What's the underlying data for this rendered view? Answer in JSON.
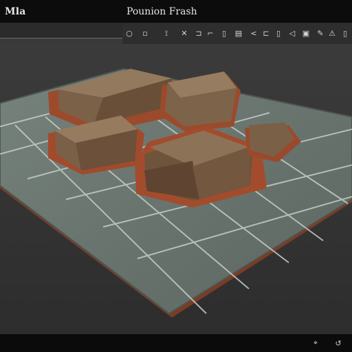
{
  "app": {
    "name": "Mla"
  },
  "document": {
    "title": "Pounion Frash"
  },
  "toolbar": {
    "tools": [
      {
        "icon": "circle-icon",
        "glyph": "○"
      },
      {
        "icon": "square-icon",
        "glyph": "▫"
      },
      {
        "icon": "pin-icon",
        "glyph": "⟟"
      },
      {
        "icon": "close-icon",
        "glyph": "✕"
      },
      {
        "icon": "bracket-icon",
        "glyph": "⊐"
      },
      {
        "icon": "crop-icon",
        "glyph": "⌐"
      },
      {
        "icon": "file-icon",
        "glyph": "▯"
      },
      {
        "icon": "document-icon",
        "glyph": "▤"
      },
      {
        "icon": "back-icon",
        "glyph": "<"
      },
      {
        "icon": "bracket-right-icon",
        "glyph": "⊏"
      },
      {
        "icon": "panel-icon",
        "glyph": "▯"
      },
      {
        "icon": "arrow-icon",
        "glyph": "◁"
      },
      {
        "icon": "image-icon",
        "glyph": "▣"
      },
      {
        "icon": "pen-icon",
        "glyph": "✎"
      },
      {
        "icon": "warning-icon",
        "glyph": "⚠"
      },
      {
        "icon": "page-icon",
        "glyph": "▯"
      }
    ]
  },
  "colors": {
    "tile": "#6b7670",
    "tile_edge": "#4a524d",
    "grout": "#c2c7c3",
    "rim": "#8b4a30",
    "block_top": "#8a7258",
    "block_side": "#6a4e36"
  },
  "status": {
    "icons": [
      {
        "icon": "cursor-icon",
        "glyph": "⌖"
      },
      {
        "icon": "sync-icon",
        "glyph": "↺"
      }
    ]
  }
}
